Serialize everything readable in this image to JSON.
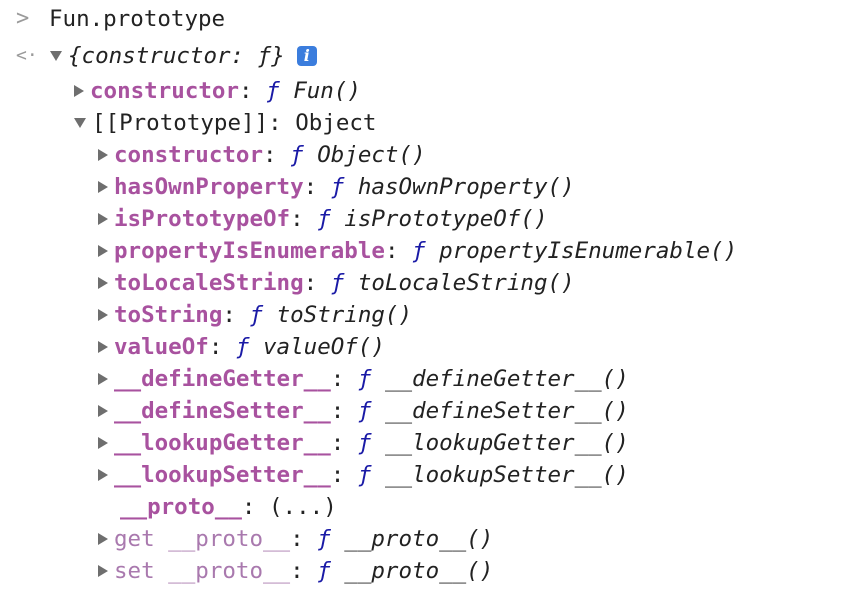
{
  "input_line": {
    "prompt_glyph": ">",
    "expression": "Fun.prototype"
  },
  "result_line": {
    "return_glyph": "<·",
    "summary": "{constructor: ƒ}",
    "info_badge": "i"
  },
  "function_glyph": "ƒ",
  "tree": [
    {
      "key": "constructor",
      "sep": ": ",
      "value": "Fun()",
      "expander": "collapsed"
    },
    {
      "key": "[[Prototype]]",
      "sep": ": ",
      "value": "Object",
      "expander": "expanded"
    },
    {
      "key": "constructor",
      "sep": ": ",
      "value": "Object()",
      "expander": "collapsed"
    },
    {
      "key": "hasOwnProperty",
      "sep": ": ",
      "value": "hasOwnProperty()",
      "expander": "collapsed"
    },
    {
      "key": "isPrototypeOf",
      "sep": ": ",
      "value": "isPrototypeOf()",
      "expander": "collapsed"
    },
    {
      "key": "propertyIsEnumerable",
      "sep": ": ",
      "value": "propertyIsEnumerable()",
      "expander": "collapsed"
    },
    {
      "key": "toLocaleString",
      "sep": ": ",
      "value": "toLocaleString()",
      "expander": "collapsed"
    },
    {
      "key": "toString",
      "sep": ": ",
      "value": "toString()",
      "expander": "collapsed"
    },
    {
      "key": "valueOf",
      "sep": ": ",
      "value": "valueOf()",
      "expander": "collapsed"
    },
    {
      "key": "__defineGetter__",
      "sep": ": ",
      "value": "__defineGetter__()",
      "expander": "collapsed"
    },
    {
      "key": "__defineSetter__",
      "sep": ": ",
      "value": "__defineSetter__()",
      "expander": "collapsed"
    },
    {
      "key": "__lookupGetter__",
      "sep": ": ",
      "value": "__lookupGetter__()",
      "expander": "collapsed"
    },
    {
      "key": "__lookupSetter__",
      "sep": ": ",
      "value": "__lookupSetter__()",
      "expander": "collapsed"
    },
    {
      "key": "__proto__",
      "sep": ": ",
      "value": "(...)",
      "expander": "none"
    },
    {
      "key": "get __proto__",
      "sep": ": ",
      "value": "__proto__()",
      "expander": "collapsed"
    },
    {
      "key": "set __proto__",
      "sep": ": ",
      "value": "__proto__()",
      "expander": "collapsed"
    }
  ],
  "colors": {
    "property_key": "#a8529f",
    "accessor_key": "#a979ae",
    "function_keyword": "#1a1aa6",
    "info_badge": "#3b7ddd",
    "expander_triangle": "#6e6e6e"
  }
}
